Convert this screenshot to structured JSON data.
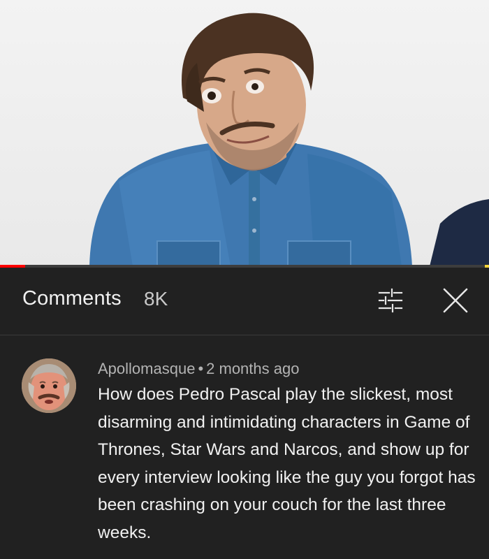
{
  "comments_panel": {
    "title": "Comments",
    "count": "8K"
  },
  "comment": {
    "author": "Apollomasque",
    "separator": "•",
    "time": "2 months ago",
    "text": "How does Pedro Pascal play the slickest, most disarming and intimidating characters in Game of Thrones, Star Wars and Narcos, and show up for every interview looking like the guy you forgot has been crashing on your couch for the last three weeks."
  },
  "icons": {
    "filter": "sort-filter-icon",
    "close": "close-icon"
  },
  "colors": {
    "panel_bg": "#212121",
    "progress_played": "#ff0000",
    "text_primary": "#f1f1f1",
    "text_secondary": "#b3b3b3"
  }
}
